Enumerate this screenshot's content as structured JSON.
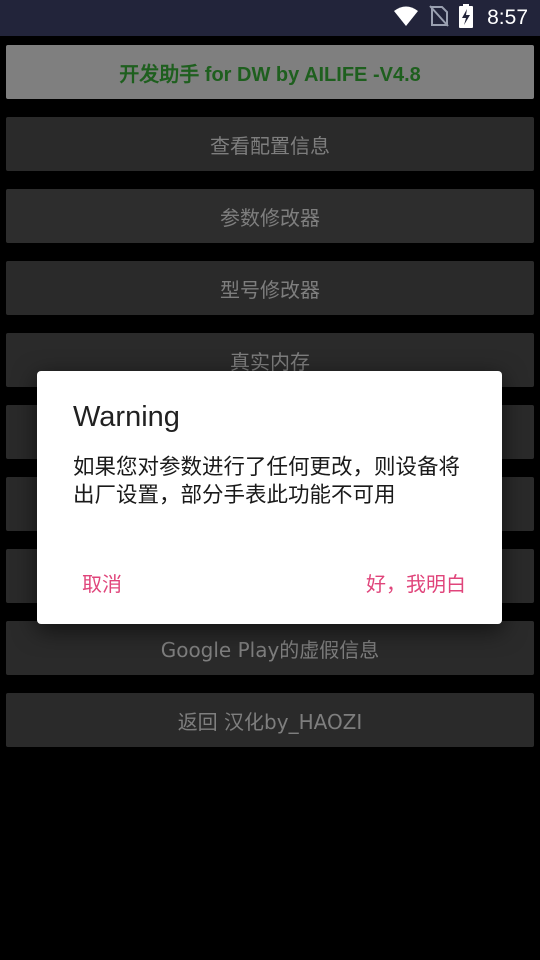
{
  "status_bar": {
    "time": "8:57",
    "icons": [
      "wifi-icon",
      "no-sim-icon",
      "battery-charging-icon"
    ]
  },
  "app": {
    "header_label": "开发助手 for DW by AILIFE -V4.8",
    "menu_items": [
      "查看配置信息",
      "参数修改器",
      "型号修改器",
      "真实内存",
      "",
      "",
      "",
      "Google Play的虚假信息",
      "返回 汉化by_HAOZI"
    ]
  },
  "dialog": {
    "title": "Warning",
    "message": "如果您对参数进行了任何更改，则设备将出厂设置，部分手表此功能不可用",
    "cancel_label": "取消",
    "ok_label": "好，我明白"
  },
  "colors": {
    "status_bar_bg": "#22243a",
    "header_button_bg": "#7f7f7f",
    "header_text": "#1e5f1e",
    "menu_button_bg": "#2a2a2a",
    "menu_text": "#7e7e7e",
    "dialog_accent": "#e0457b"
  }
}
